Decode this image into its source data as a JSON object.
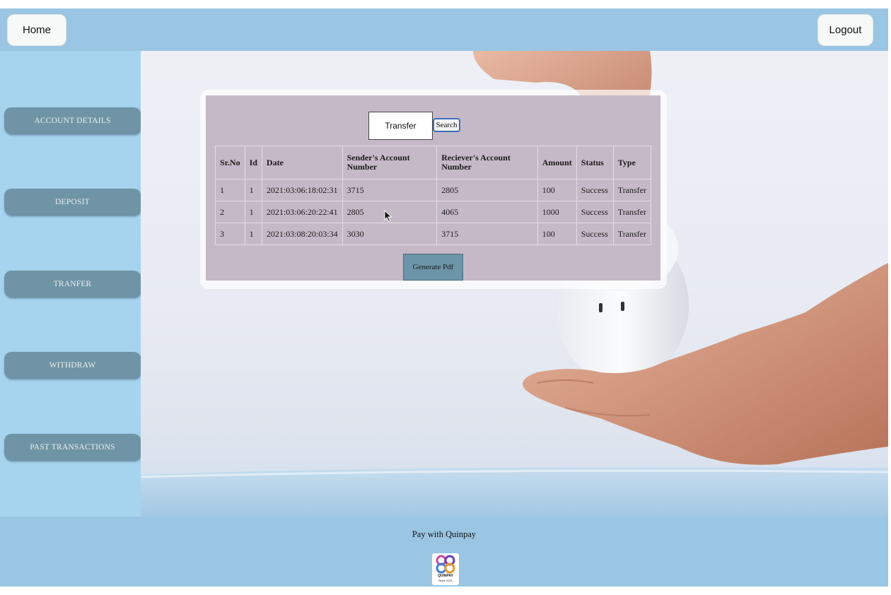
{
  "topbar": {
    "home_label": "Home",
    "logout_label": "Logout",
    "color": "#9ac6e3"
  },
  "sidebar": {
    "items": [
      {
        "label": "ACCOUNT DETAILS"
      },
      {
        "label": "DEPOSIT"
      },
      {
        "label": "TRANFER"
      },
      {
        "label": "WITHDRAW"
      },
      {
        "label": "PAST TRANSACTIONS"
      }
    ],
    "button_color": "#6f94a5"
  },
  "search": {
    "value": "Transfer",
    "button_label": "Search"
  },
  "table": {
    "headers": [
      "Sr.No",
      "Id",
      "Date",
      "Sender's Account Number",
      "Reciever's Account Number",
      "Amount",
      "Status",
      "Type"
    ],
    "rows": [
      [
        "1",
        "1",
        "2021:03:06:18:02:31",
        "3715",
        "2805",
        "100",
        "Success",
        "Transfer"
      ],
      [
        "2",
        "1",
        "2021:03:06:20:22:41",
        "2805",
        "4065",
        "1000",
        "Success",
        "Transfer"
      ],
      [
        "3",
        "1",
        "2021:03:08:20:03:34",
        "3030",
        "3715",
        "100",
        "Success",
        "Transfer"
      ]
    ]
  },
  "generate_pdf_label": "Generate Pdf",
  "footer": {
    "text": "Pay with Quinpay",
    "logo_name": "QUINPAY",
    "logo_tagline": "Since 2021"
  },
  "icons": {
    "cursor": "mouse-pointer-icon",
    "logo": "quinpay-logo-icon"
  }
}
